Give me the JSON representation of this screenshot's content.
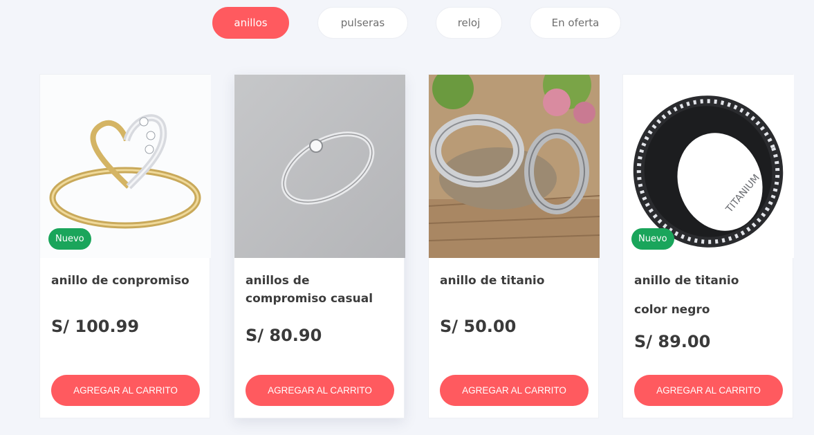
{
  "tabs": [
    {
      "label": "anillos",
      "active": true
    },
    {
      "label": "pulseras",
      "active": false
    },
    {
      "label": "reloj",
      "active": false
    },
    {
      "label": "En oferta",
      "active": false
    }
  ],
  "products": [
    {
      "title": "anillo de conpromiso",
      "subtitle": "",
      "price": "S/ 100.99",
      "badge": "Nuevo",
      "button": "AGREGAR AL CARRITO",
      "image": "gold-heart-ring"
    },
    {
      "title": "anillos de compromiso casual",
      "subtitle": "",
      "price": "S/ 80.90",
      "badge": "",
      "button": "AGREGAR AL CARRITO",
      "image": "silver-solitaire-ring"
    },
    {
      "title": "anillo de titanio",
      "subtitle": "",
      "price": "S/ 50.00",
      "badge": "",
      "button": "AGREGAR AL CARRITO",
      "image": "titanium-bands-photo"
    },
    {
      "title": "anillo de titanio",
      "subtitle": "color negro",
      "price": "S/ 89.00",
      "badge": "Nuevo",
      "button": "AGREGAR AL CARRITO",
      "image": "black-titanium-ring",
      "engraving": "TITANIUM"
    }
  ],
  "colors": {
    "accent": "#ff5a5f",
    "badge": "#1aa55b"
  }
}
